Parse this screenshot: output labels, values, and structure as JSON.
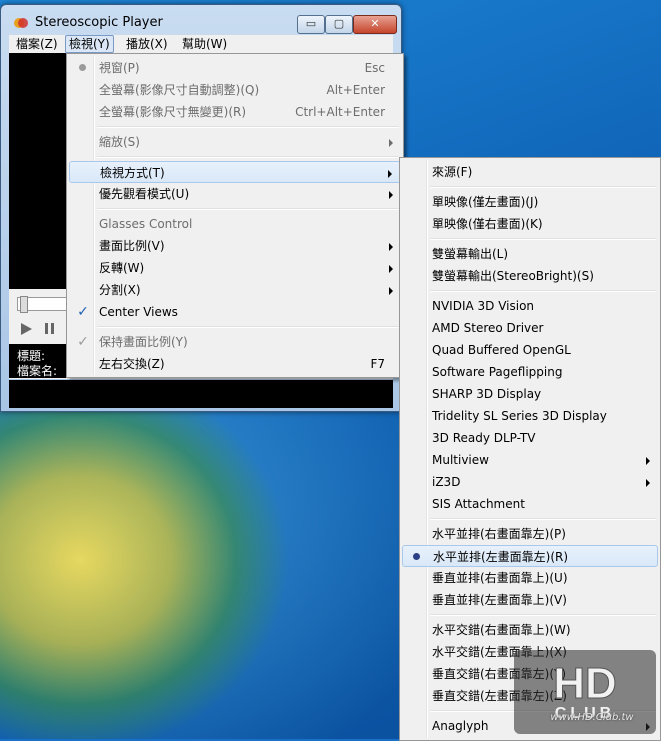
{
  "window": {
    "title": "Stereoscopic Player",
    "min": "▭",
    "max": "▢",
    "close": "✕"
  },
  "menubar": [
    "檔案(Z)",
    "檢視(Y)",
    "播放(X)",
    "幫助(W)"
  ],
  "info": {
    "title_label": "標題:",
    "file_label": "檔案名:"
  },
  "view_menu": [
    {
      "label": "視窗(P)",
      "shortcut": "Esc",
      "disabled": true,
      "mark": "dot"
    },
    {
      "label": "全螢幕(影像尺寸自動調整)(Q)",
      "shortcut": "Alt+Enter",
      "disabled": true
    },
    {
      "label": "全螢幕(影像尺寸無變更)(R)",
      "shortcut": "Ctrl+Alt+Enter",
      "disabled": true
    },
    {
      "sep": true
    },
    {
      "label": "縮放(S)",
      "disabled": true,
      "submenu": true
    },
    {
      "sep": true
    },
    {
      "label": "檢視方式(T)",
      "submenu": true,
      "highlight": true
    },
    {
      "label": "優先觀看模式(U)",
      "submenu": true
    },
    {
      "sep": true
    },
    {
      "label": "Glasses Control",
      "disabled": true
    },
    {
      "label": "畫面比例(V)",
      "submenu": true
    },
    {
      "label": "反轉(W)",
      "submenu": true
    },
    {
      "label": "分割(X)",
      "submenu": true
    },
    {
      "label": "Center Views",
      "mark": "check"
    },
    {
      "sep": true
    },
    {
      "label": "保持畫面比例(Y)",
      "disabled": true,
      "mark": "check-dis"
    },
    {
      "label": "左右交換(Z)",
      "shortcut": "F7"
    }
  ],
  "viewmode_menu": [
    {
      "label": "來源(F)"
    },
    {
      "sep": true
    },
    {
      "label": "單映像(僅左畫面)(J)"
    },
    {
      "label": "單映像(僅右畫面)(K)"
    },
    {
      "sep": true
    },
    {
      "label": "雙螢幕輸出(L)"
    },
    {
      "label": "雙螢幕輸出(StereoBright)(S)"
    },
    {
      "sep": true
    },
    {
      "label": "NVIDIA 3D Vision"
    },
    {
      "label": "AMD Stereo Driver"
    },
    {
      "label": "Quad Buffered OpenGL"
    },
    {
      "label": "Software Pageflipping"
    },
    {
      "label": "SHARP 3D Display"
    },
    {
      "label": "Tridelity SL Series 3D Display"
    },
    {
      "label": "3D Ready DLP-TV"
    },
    {
      "label": "Multiview",
      "submenu": true
    },
    {
      "label": "iZ3D",
      "submenu": true
    },
    {
      "label": "SIS Attachment"
    },
    {
      "sep": true
    },
    {
      "label": "水平並排(右畫面靠左)(P)"
    },
    {
      "label": "水平並排(左畫面靠左)(R)",
      "mark": "dot",
      "highlight": true
    },
    {
      "label": "垂直並排(右畫面靠上)(U)"
    },
    {
      "label": "垂直並排(左畫面靠上)(V)"
    },
    {
      "sep": true
    },
    {
      "label": "水平交錯(右畫面靠上)(W)"
    },
    {
      "label": "水平交錯(左畫面靠上)(X)"
    },
    {
      "label": "垂直交錯(右畫面靠左)(Y)"
    },
    {
      "label": "垂直交錯(左畫面靠左)(Z)"
    },
    {
      "sep": true
    },
    {
      "label": "Anaglyph",
      "submenu": true
    }
  ],
  "watermark": {
    "text": "www.HD.Club.tw"
  },
  "colors": {
    "highlight": "#d9e8f8",
    "accent": "#1d5fb4",
    "desktop": "#0f62b5"
  }
}
